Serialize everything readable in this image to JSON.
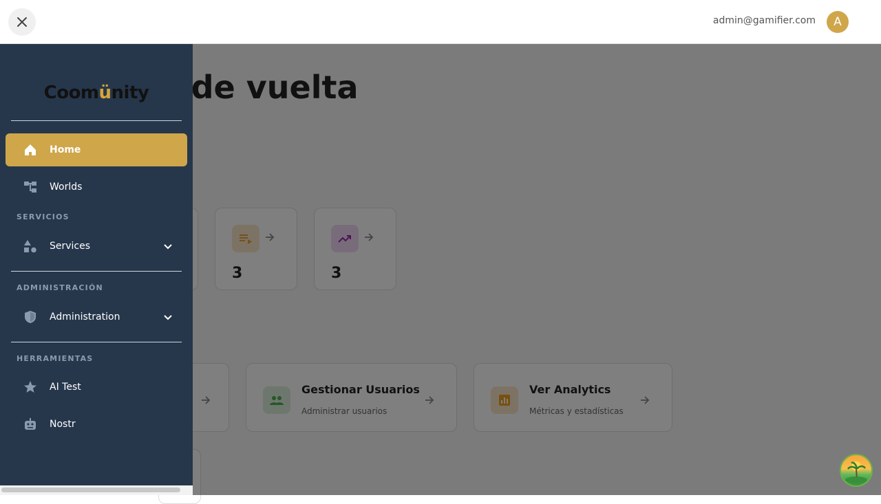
{
  "topbar": {
    "user_email": "admin@gamifier.com",
    "avatar_letter": "A"
  },
  "main": {
    "welcome_visible": "o de vuelta",
    "stats": [
      {
        "icon": "playlist-play-icon",
        "value": "3",
        "color": "#e8a33d"
      },
      {
        "icon": "trending-up-icon",
        "value": "3",
        "color": "#9c27b0"
      }
    ],
    "actions": [
      {
        "title": "Gestionar Usuarios",
        "subtitle": "Administrar usuarios",
        "icon": "group-icon",
        "color": "#4caf50"
      },
      {
        "title": "Ver Analytics",
        "subtitle": "Métricas y estadísticas",
        "icon": "analytics-icon",
        "color": "#f0a020"
      }
    ]
  },
  "sidebar": {
    "logo": {
      "prefix": "Coom",
      "dots": "ü",
      "suffix": "nity"
    },
    "items": [
      {
        "label": "Home",
        "icon": "home-icon",
        "active": true
      },
      {
        "label": "Worlds",
        "icon": "account-tree-icon"
      }
    ],
    "sections": [
      {
        "label": "SERVICIOS",
        "items": [
          {
            "label": "Services",
            "icon": "category-icon"
          }
        ]
      },
      {
        "label": "ADMINISTRACIÓN",
        "items": [
          {
            "label": "Administration",
            "icon": "shield-icon"
          }
        ]
      },
      {
        "label": "HERRAMIENTAS",
        "items": [
          {
            "label": "AI Test",
            "icon": "star-icon"
          },
          {
            "label": "Nostr",
            "icon": "robot-icon"
          }
        ]
      }
    ]
  },
  "colors": {
    "sidebar_bg": "#26374c",
    "active_item": "#cfa64a",
    "avatar_bg": "#cfa64a"
  }
}
